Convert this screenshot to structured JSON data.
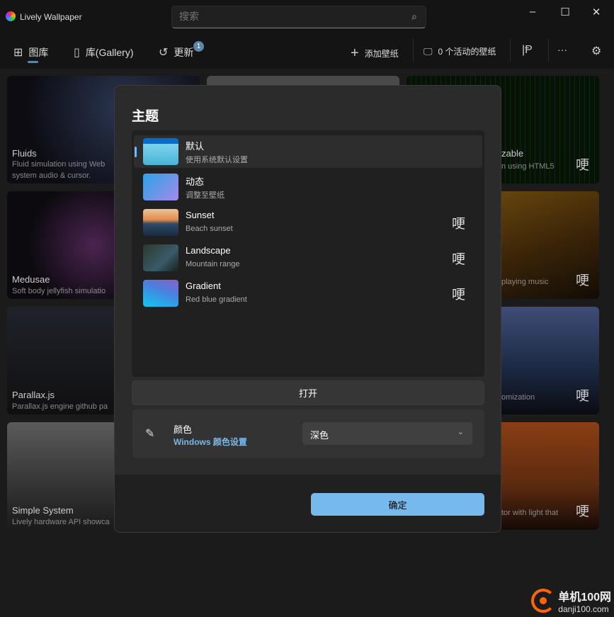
{
  "app": {
    "title": "Lively Wallpaper",
    "logo_icon": "lively-logo"
  },
  "search": {
    "placeholder": "搜索",
    "icon": "search-icon"
  },
  "window_controls": {
    "minimize": "–",
    "maximize": "☐",
    "close": "✕"
  },
  "nav": {
    "tabs": [
      {
        "label": "图库",
        "icon": "grid-icon",
        "active": true
      },
      {
        "label": "库(Gallery)",
        "icon": "bag-icon"
      },
      {
        "label": "更新",
        "icon": "refresh-icon",
        "badge": "1"
      }
    ],
    "add_wallpaper": "添加壁纸",
    "active_wallpapers": "0 个活动的壁纸",
    "more": "···",
    "accent": "#5b87ab"
  },
  "cards": [
    {
      "title": "Fluids",
      "desc": [
        "Fluid simulation using Web",
        "system audio & cursor."
      ]
    },
    {
      "title": "Medusae",
      "desc": [
        "Soft body jellyfish simulatio"
      ]
    },
    {
      "title": "Parallax.js",
      "desc": [
        "Parallax.js engine github pa"
      ]
    },
    {
      "title": "Simple System",
      "desc": [
        "Lively hardware API showca"
      ]
    },
    {
      "title": "zable",
      "desc": [
        "n using HTML5"
      ],
      "glyph": "哽"
    },
    {
      "title": "",
      "desc": [
        "playing music"
      ],
      "glyph": "哽"
    },
    {
      "title": "",
      "desc": [
        "omization"
      ],
      "glyph": "哽"
    },
    {
      "title": "",
      "desc": [
        "tor with light that"
      ],
      "glyph": "哽"
    }
  ],
  "dialog": {
    "title": "主题",
    "themes": [
      {
        "name": "默认",
        "desc": "使用系统默认设置",
        "selected": true
      },
      {
        "name": "动态",
        "desc": "调整至壁纸"
      },
      {
        "name": "Sunset",
        "desc": "Beach sunset",
        "glyph": "哽"
      },
      {
        "name": "Landscape",
        "desc": "Mountain range",
        "glyph": "哽"
      },
      {
        "name": "Gradient",
        "desc": "Red blue gradient",
        "glyph": "哽"
      }
    ],
    "open_button": "打开",
    "color": {
      "label": "颜色",
      "link": "Windows 颜色设置",
      "selected": "深色",
      "icon": "personalize-icon"
    },
    "ok_button": "确定",
    "accent": "#76b9ed"
  },
  "watermark": {
    "name": "单机100网",
    "url": "danji100.com"
  }
}
